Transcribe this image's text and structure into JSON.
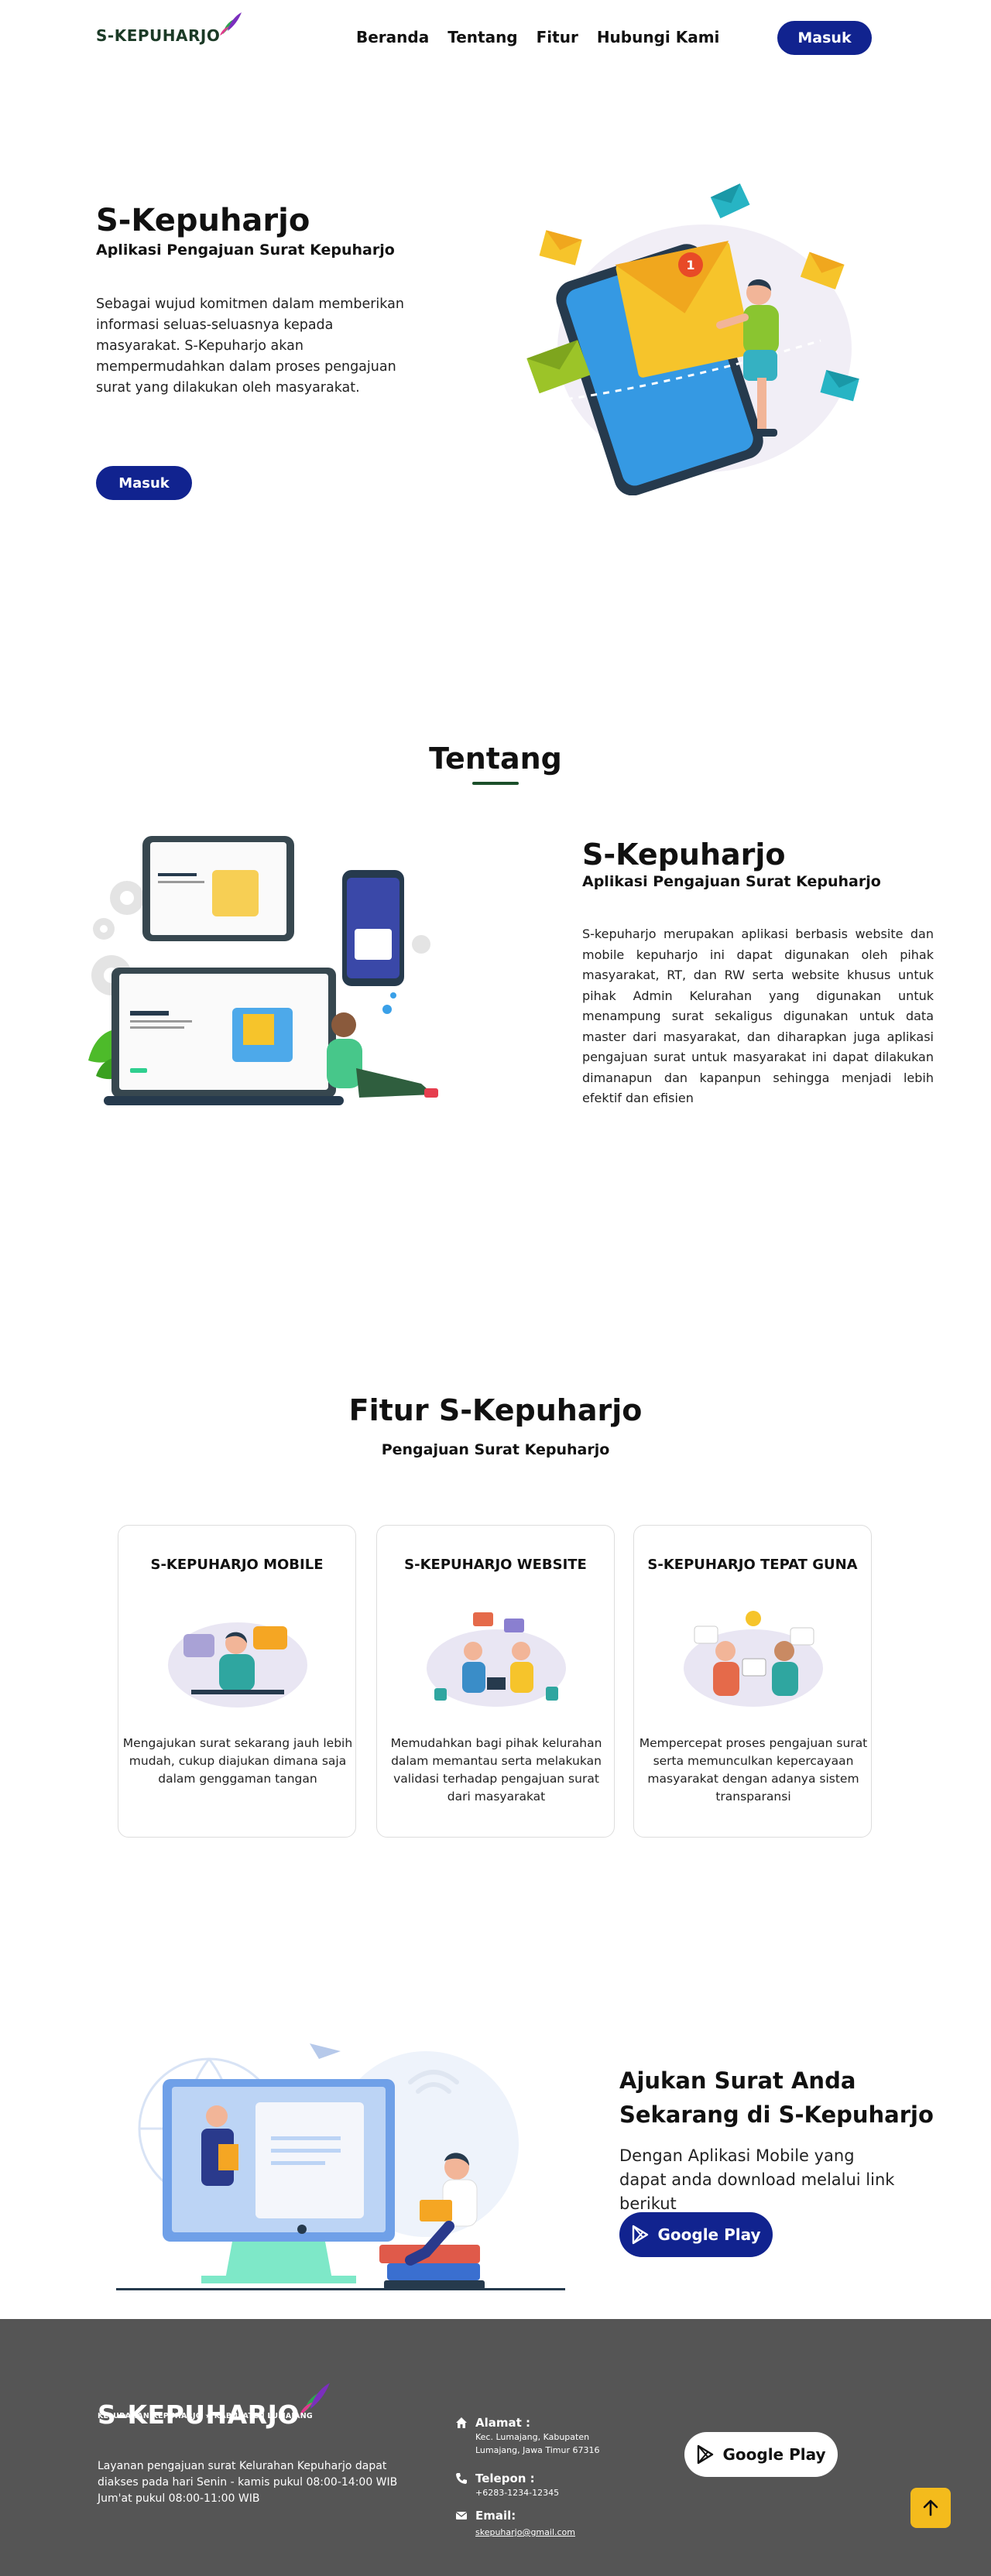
{
  "nav": {
    "logo": "S-KEPUHARJO",
    "links": [
      "Beranda",
      "Tentang",
      "Fitur",
      "Hubungi Kami"
    ],
    "login": "Masuk"
  },
  "hero": {
    "title": "S-Kepuharjo",
    "subtitle": "Aplikasi Pengajuan Surat Kepuharjo",
    "description": "Sebagai wujud komitmen dalam memberikan informasi seluas-seluasnya kepada masyarakat. S-Kepuharjo akan mempermudahkan dalam proses pengajuan surat yang dilakukan oleh masyarakat.",
    "button": "Masuk",
    "badge": "1"
  },
  "tentang": {
    "heading": "Tentang",
    "title": "S-Kepuharjo",
    "subtitle": "Aplikasi Pengajuan Surat Kepuharjo",
    "description": "S-kepuharjo merupakan aplikasi berbasis website dan mobile kepuharjo ini dapat digunakan oleh pihak masyarakat, RT, dan RW serta website khusus untuk pihak Admin Kelurahan yang digunakan untuk menampung surat sekaligus digunakan untuk data master dari masyarakat, dan diharapkan juga aplikasi pengajuan surat untuk masyarakat ini dapat dilakukan dimanapun dan kapanpun sehingga menjadi lebih efektif dan efisien"
  },
  "fitur": {
    "heading": "Fitur S-Kepuharjo",
    "subtitle": "Pengajuan Surat Kepuharjo",
    "cards": [
      {
        "title": "S-KEPUHARJO MOBILE",
        "description": "Mengajukan surat sekarang jauh lebih mudah, cukup diajukan dimana saja dalam genggaman tangan"
      },
      {
        "title": "S-KEPUHARJO WEBSITE",
        "description": "Memudahkan bagi pihak kelurahan dalam memantau serta melakukan validasi terhadap pengajuan surat dari masyarakat"
      },
      {
        "title": "S-KEPUHARJO TEPAT GUNA",
        "description": "Mempercepat proses pengajuan surat serta memunculkan kepercayaan masyarakat dengan adanya sistem transparansi"
      }
    ]
  },
  "cta": {
    "title": "Ajukan Surat Anda Sekarang di S-Kepuharjo",
    "description": "Dengan Aplikasi Mobile yang dapat anda download melalui link berikut",
    "button": "Google Play"
  },
  "footer": {
    "logo": "S-KEPUHARJO",
    "tagline": "KELURAHAN KEPUHARJO  ★  KABUPATEN LUMAJANG",
    "description": "Layanan pengajuan surat Kelurahan Kepuharjo dapat diakses pada hari Senin - kamis pukul 08:00-14:00 WIB Jum'at pukul 08:00-11:00 WIB",
    "address_label": "Alamat :",
    "address": "Kec. Lumajang, Kabupaten Lumajang, Jawa Timur 67316",
    "phone_label": "Telepon :",
    "phone": "+6283-1234-12345",
    "email_label": "Email:",
    "email": "skepuharjo@gmail.com",
    "button": "Google Play"
  },
  "colors": {
    "primary": "#11238f",
    "footer": "#555555",
    "accent_green": "#1b4f2a",
    "scroll_top": "#f4bb1c"
  }
}
